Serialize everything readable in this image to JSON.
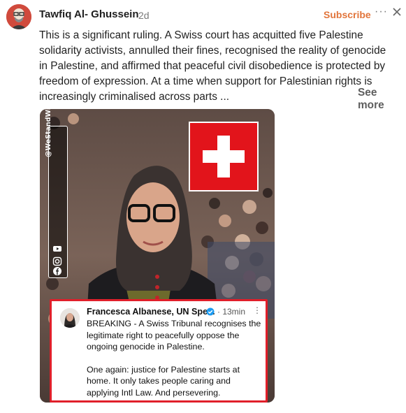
{
  "post": {
    "author": "Tawfiq Al- Ghussein",
    "time": "2d",
    "subscribe_label": "Subscribe",
    "more_menu": "···",
    "text": "This is a significant ruling. A Swiss court has acquitted five Palestine solidarity activists, annulled their fines, recognised the reality of genocide in Palestine, and affirmed that peaceful civil disobedience is protected by freedom of expression. At a time when support for Palestinian rights is increasingly criminalised across parts ...",
    "see_more": "See more"
  },
  "image": {
    "handle": "@WeStandWithFrancescaAlbanese",
    "icons": [
      "youtube-icon",
      "instagram-icon",
      "facebook-icon"
    ],
    "flag_colors": {
      "red": "#e2141b",
      "cross": "#ffffff"
    },
    "tweet": {
      "name": "Francesca Albanese, UN Spe...",
      "time": "· 13min",
      "menu": "⋮",
      "paragraph1": "BREAKING - A Swiss Tribunal recognises the legitimate right to peacefully oppose the ongoing genocide in Palestine.",
      "paragraph2": "One again: justice for Palestine starts at home. It only takes  people caring and applying Intl Law. And persevering."
    }
  },
  "colors": {
    "subscribe": "#e2753b",
    "tweet_border": "#e01f2a"
  }
}
